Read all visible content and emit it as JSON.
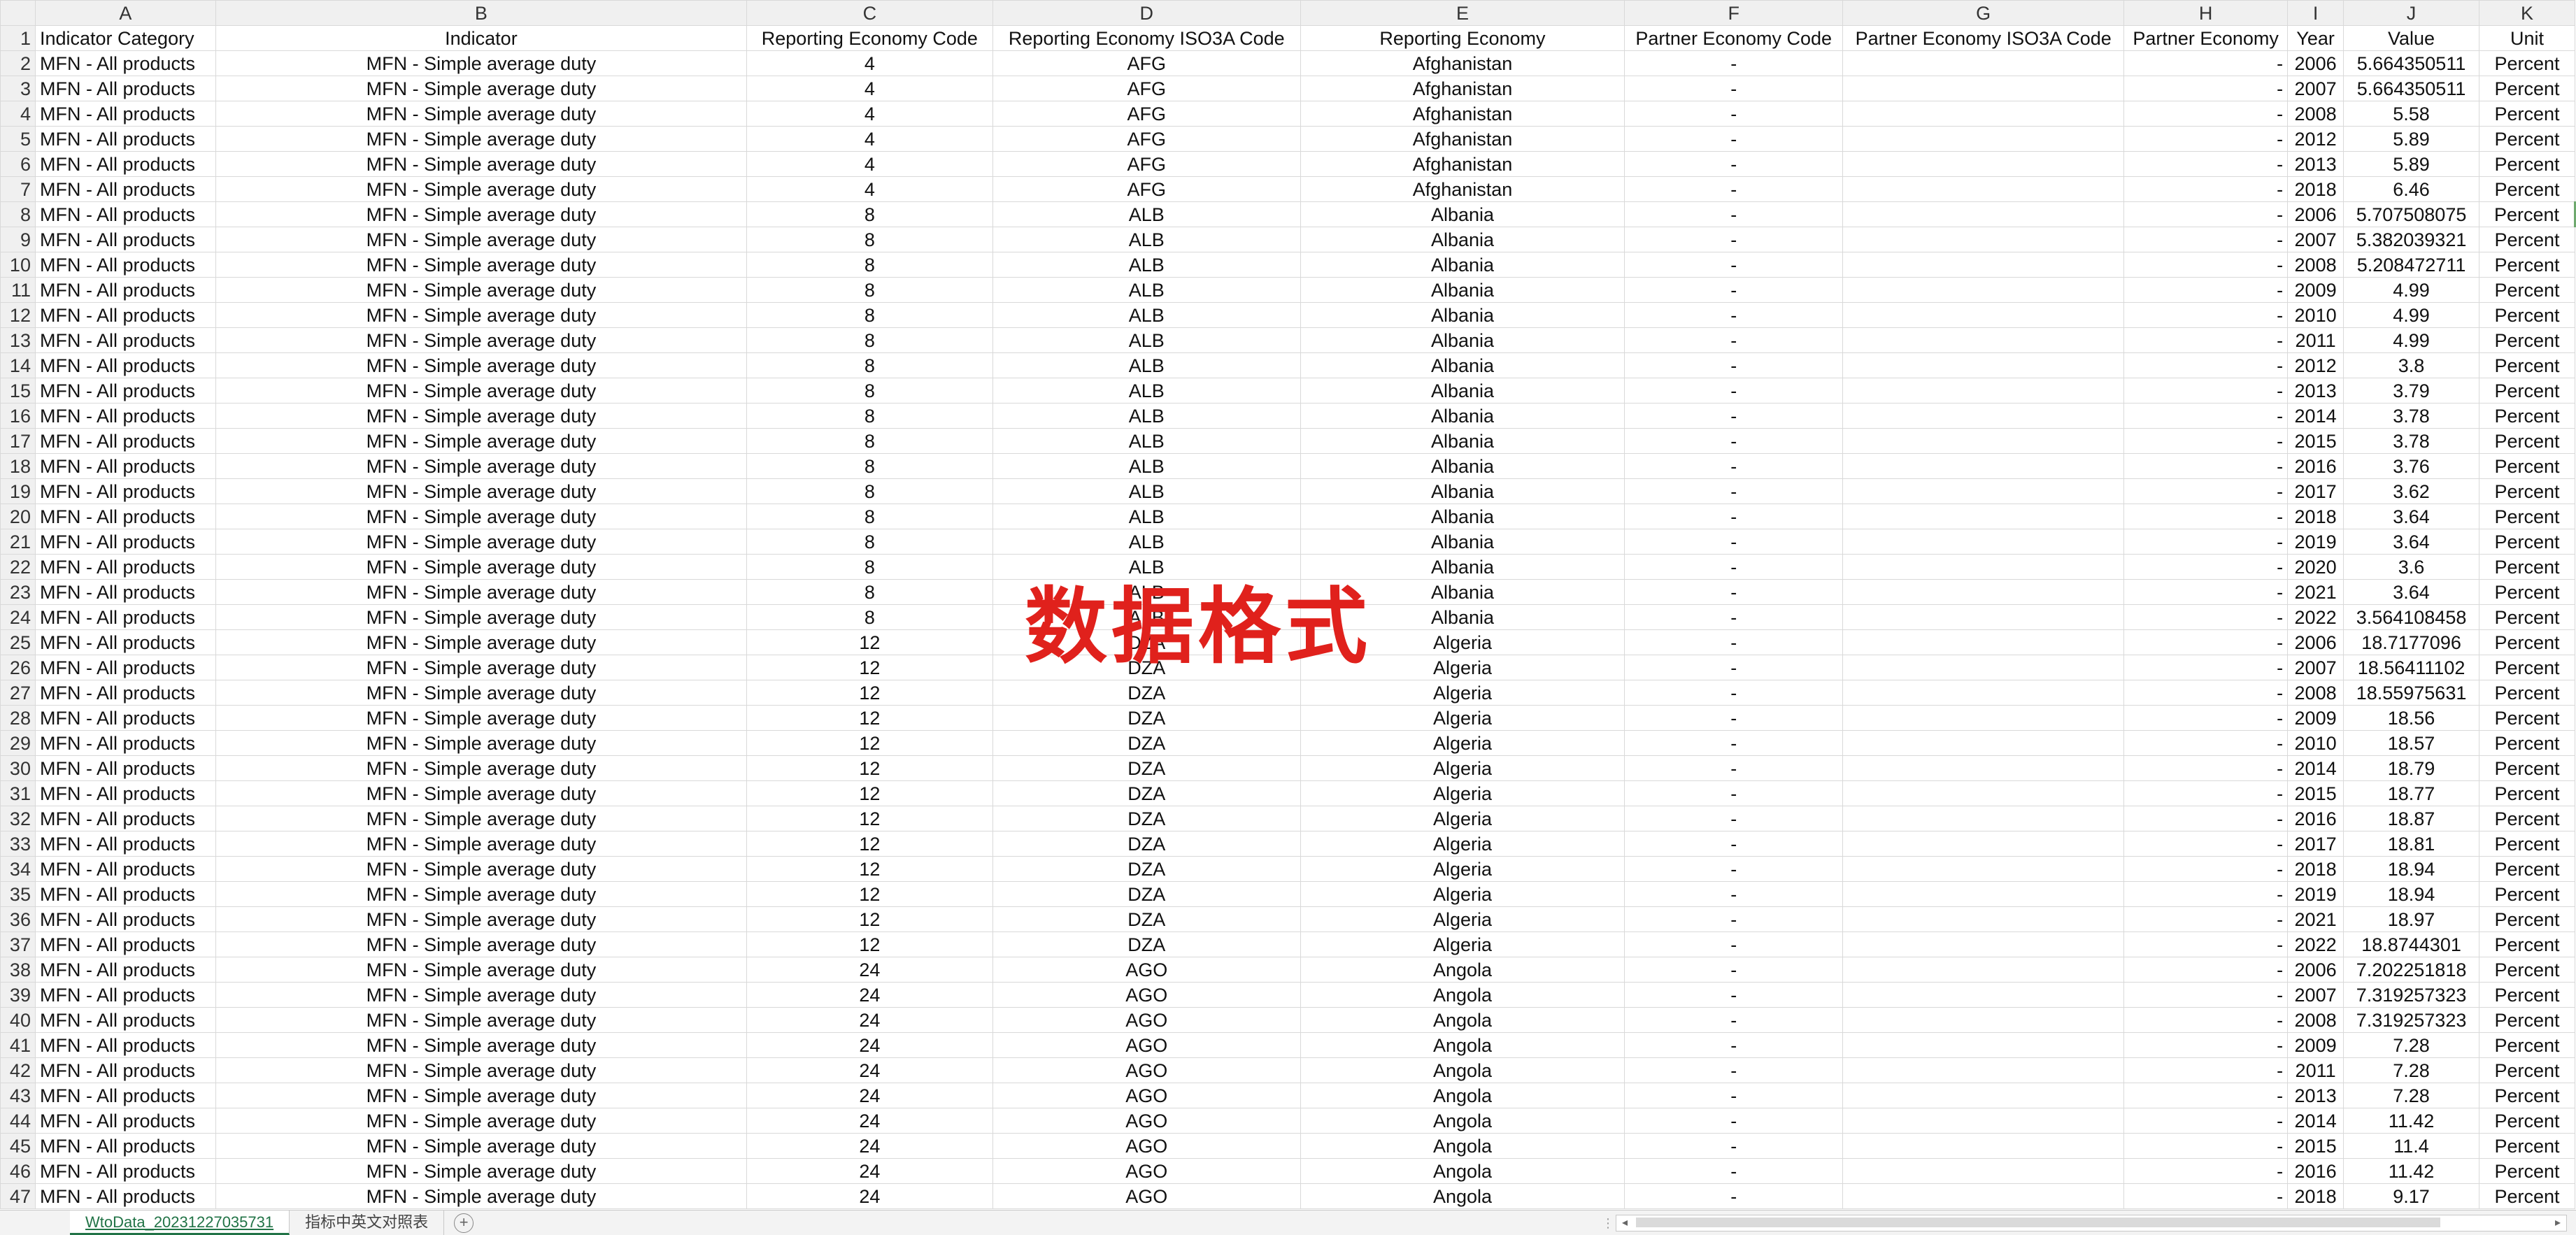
{
  "column_letters": [
    "A",
    "B",
    "C",
    "D",
    "E",
    "F",
    "G",
    "H",
    "I",
    "J",
    "K"
  ],
  "headers": [
    "Indicator Category",
    "Indicator",
    "Reporting Economy Code",
    "Reporting Economy ISO3A Code",
    "Reporting Economy",
    "Partner Economy Code",
    "Partner Economy ISO3A Code",
    "Partner Economy",
    "Year",
    "Value",
    "Unit"
  ],
  "common": {
    "category": "MFN - All products",
    "indicator": "MFN -  Simple average duty",
    "partner_code": "-",
    "partner_iso": "",
    "partner_name": "-",
    "unit": "Percent"
  },
  "rows": [
    [
      "4",
      "AFG",
      "Afghanistan",
      "2006",
      "5.664350511"
    ],
    [
      "4",
      "AFG",
      "Afghanistan",
      "2007",
      "5.664350511"
    ],
    [
      "4",
      "AFG",
      "Afghanistan",
      "2008",
      "5.58"
    ],
    [
      "4",
      "AFG",
      "Afghanistan",
      "2012",
      "5.89"
    ],
    [
      "4",
      "AFG",
      "Afghanistan",
      "2013",
      "5.89"
    ],
    [
      "4",
      "AFG",
      "Afghanistan",
      "2018",
      "6.46"
    ],
    [
      "8",
      "ALB",
      "Albania",
      "2006",
      "5.707508075"
    ],
    [
      "8",
      "ALB",
      "Albania",
      "2007",
      "5.382039321"
    ],
    [
      "8",
      "ALB",
      "Albania",
      "2008",
      "5.208472711"
    ],
    [
      "8",
      "ALB",
      "Albania",
      "2009",
      "4.99"
    ],
    [
      "8",
      "ALB",
      "Albania",
      "2010",
      "4.99"
    ],
    [
      "8",
      "ALB",
      "Albania",
      "2011",
      "4.99"
    ],
    [
      "8",
      "ALB",
      "Albania",
      "2012",
      "3.8"
    ],
    [
      "8",
      "ALB",
      "Albania",
      "2013",
      "3.79"
    ],
    [
      "8",
      "ALB",
      "Albania",
      "2014",
      "3.78"
    ],
    [
      "8",
      "ALB",
      "Albania",
      "2015",
      "3.78"
    ],
    [
      "8",
      "ALB",
      "Albania",
      "2016",
      "3.76"
    ],
    [
      "8",
      "ALB",
      "Albania",
      "2017",
      "3.62"
    ],
    [
      "8",
      "ALB",
      "Albania",
      "2018",
      "3.64"
    ],
    [
      "8",
      "ALB",
      "Albania",
      "2019",
      "3.64"
    ],
    [
      "8",
      "ALB",
      "Albania",
      "2020",
      "3.6"
    ],
    [
      "8",
      "ALB",
      "Albania",
      "2021",
      "3.64"
    ],
    [
      "8",
      "ALB",
      "Albania",
      "2022",
      "3.564108458"
    ],
    [
      "12",
      "DZA",
      "Algeria",
      "2006",
      "18.7177096"
    ],
    [
      "12",
      "DZA",
      "Algeria",
      "2007",
      "18.56411102"
    ],
    [
      "12",
      "DZA",
      "Algeria",
      "2008",
      "18.55975631"
    ],
    [
      "12",
      "DZA",
      "Algeria",
      "2009",
      "18.56"
    ],
    [
      "12",
      "DZA",
      "Algeria",
      "2010",
      "18.57"
    ],
    [
      "12",
      "DZA",
      "Algeria",
      "2014",
      "18.79"
    ],
    [
      "12",
      "DZA",
      "Algeria",
      "2015",
      "18.77"
    ],
    [
      "12",
      "DZA",
      "Algeria",
      "2016",
      "18.87"
    ],
    [
      "12",
      "DZA",
      "Algeria",
      "2017",
      "18.81"
    ],
    [
      "12",
      "DZA",
      "Algeria",
      "2018",
      "18.94"
    ],
    [
      "12",
      "DZA",
      "Algeria",
      "2019",
      "18.94"
    ],
    [
      "12",
      "DZA",
      "Algeria",
      "2021",
      "18.97"
    ],
    [
      "12",
      "DZA",
      "Algeria",
      "2022",
      "18.8744301"
    ],
    [
      "24",
      "AGO",
      "Angola",
      "2006",
      "7.202251818"
    ],
    [
      "24",
      "AGO",
      "Angola",
      "2007",
      "7.319257323"
    ],
    [
      "24",
      "AGO",
      "Angola",
      "2008",
      "7.319257323"
    ],
    [
      "24",
      "AGO",
      "Angola",
      "2009",
      "7.28"
    ],
    [
      "24",
      "AGO",
      "Angola",
      "2011",
      "7.28"
    ],
    [
      "24",
      "AGO",
      "Angola",
      "2013",
      "7.28"
    ],
    [
      "24",
      "AGO",
      "Angola",
      "2014",
      "11.42"
    ],
    [
      "24",
      "AGO",
      "Angola",
      "2015",
      "11.4"
    ],
    [
      "24",
      "AGO",
      "Angola",
      "2016",
      "11.42"
    ],
    [
      "24",
      "AGO",
      "Angola",
      "2018",
      "9.17"
    ]
  ],
  "watermark": "数据格式",
  "sheet_tabs": [
    {
      "label": "WtoData_20231227035731",
      "active": true
    },
    {
      "label": "指标中英文对照表",
      "active": false
    }
  ],
  "add_sheet_glyph": "+",
  "icons": {
    "add": "plus-circle-icon",
    "scroll_left": "arrow-left-icon",
    "scroll_right": "arrow-right-icon"
  },
  "colors": {
    "grid": "#d9d9d9",
    "header_bg": "#f0f0f0",
    "active_tab": "#217346",
    "watermark": "#e0211c"
  }
}
